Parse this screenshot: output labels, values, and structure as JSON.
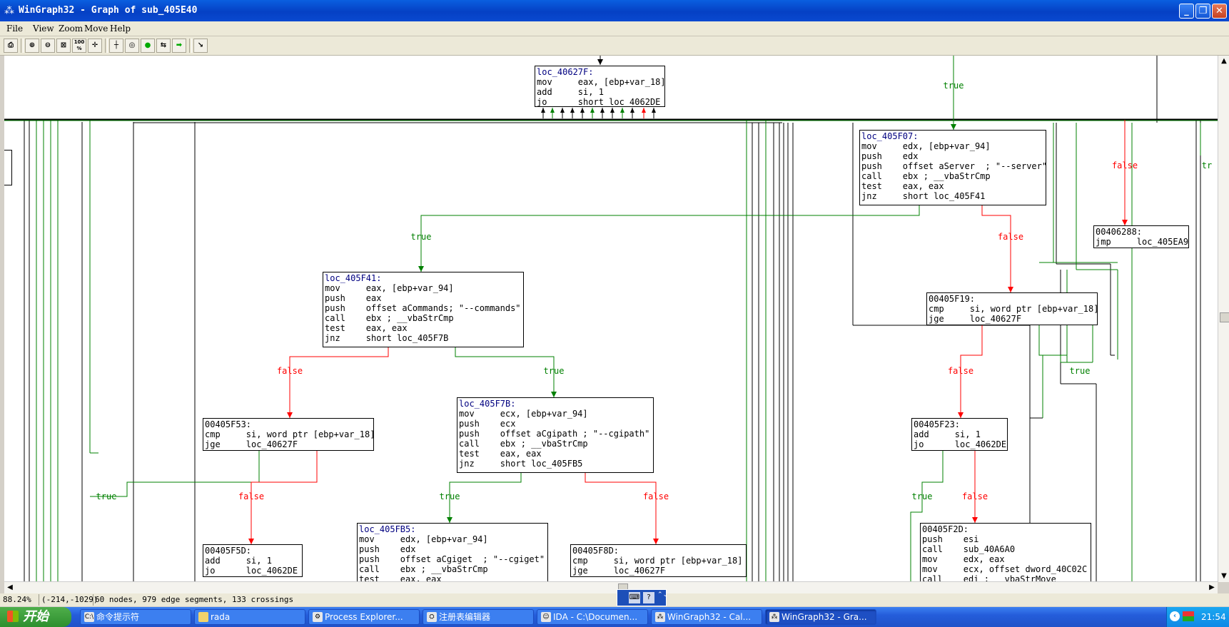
{
  "window": {
    "title": "WinGraph32 - Graph of sub_405E40",
    "minimize": "_",
    "restore": "❐",
    "close": "✕"
  },
  "menu": [
    "File",
    "View",
    "Zoom",
    "Move",
    "Help"
  ],
  "toolbar": {
    "buttons": [
      "print-icon",
      "zoom-in-icon",
      "zoom-out-icon",
      "fit-icon",
      "zoom-100-icon",
      "center-icon",
      "layout-icon",
      "circle-icon",
      "green-circle-icon",
      "swap-icon",
      "green-arrow-icon",
      "cursor-icon"
    ],
    "zoom_100_label": "100 %"
  },
  "graph": {
    "nodes": [
      {
        "id": "n-40627f",
        "lines": [
          "loc_40627F:",
          "mov     eax, [ebp+var_18]",
          "add     si, 1",
          "jo      short loc_4062DE"
        ]
      },
      {
        "id": "n-405f07",
        "lines": [
          "loc_405F07:",
          "mov     edx, [ebp+var_94]",
          "push    edx",
          "push    offset aServer  ; \"--server\"",
          "call    ebx ; __vbaStrCmp",
          "test    eax, eax",
          "jnz     short loc_405F41"
        ]
      },
      {
        "id": "n-406288",
        "lines": [
          "00406288:",
          "jmp     loc_405EA9"
        ]
      },
      {
        "id": "n-405f41",
        "lines": [
          "loc_405F41:",
          "mov     eax, [ebp+var_94]",
          "push    eax",
          "push    offset aCommands; \"--commands\"",
          "call    ebx ; __vbaStrCmp",
          "test    eax, eax",
          "jnz     short loc_405F7B"
        ]
      },
      {
        "id": "n-405f19",
        "lines": [
          "00405F19:",
          "cmp     si, word ptr [ebp+var_18]",
          "jge     loc_40627F"
        ]
      },
      {
        "id": "n-405f53",
        "lines": [
          "00405F53:",
          "cmp     si, word ptr [ebp+var_18]",
          "jge     loc_40627F"
        ]
      },
      {
        "id": "n-405f7b",
        "lines": [
          "loc_405F7B:",
          "mov     ecx, [ebp+var_94]",
          "push    ecx",
          "push    offset aCgipath ; \"--cgipath\"",
          "call    ebx ; __vbaStrCmp",
          "test    eax, eax",
          "jnz     short loc_405FB5"
        ]
      },
      {
        "id": "n-405f23",
        "lines": [
          "00405F23:",
          "add     si, 1",
          "jo      loc_4062DE"
        ]
      },
      {
        "id": "n-405f5d",
        "lines": [
          "00405F5D:",
          "add     si, 1",
          "jo      loc_4062DE"
        ]
      },
      {
        "id": "n-405fb5",
        "lines": [
          "loc_405FB5:",
          "mov     edx, [ebp+var_94]",
          "push    edx",
          "push    offset aCgiget  ; \"--cgiget\"",
          "call    ebx ; __vbaStrCmp",
          "test    eax, eax"
        ]
      },
      {
        "id": "n-405f8d",
        "lines": [
          "00405F8D:",
          "cmp     si, word ptr [ebp+var_18]",
          "jge     loc_40627F"
        ]
      },
      {
        "id": "n-405f2d",
        "lines": [
          "00405F2D:",
          "push    esi",
          "call    sub_40A6A0",
          "mov     edx, eax",
          "mov     ecx, offset dword_40C02C",
          "call    edi ; __vbaStrMove"
        ]
      }
    ],
    "edge_labels": {
      "true": "true",
      "false": "false",
      "tr": "tr"
    },
    "colors": {
      "true": "#008000",
      "false": "#ff0000",
      "plain": "#000000",
      "label_text": "#000080"
    }
  },
  "status": {
    "zoom": "88.24%",
    "position": "(-214,-1029)",
    "summary": "60 nodes, 979 edge segments, 133 crossings"
  },
  "taskbar": {
    "start": "开始",
    "tasks": [
      {
        "label": "命令提示符",
        "icon": "C:\\"
      },
      {
        "label": "rada",
        "icon": "📁"
      },
      {
        "label": "Process Explorer...",
        "icon": "⚙"
      },
      {
        "label": "注册表编辑器",
        "icon": "⛭"
      },
      {
        "label": "IDA - C:\\Documen...",
        "icon": "☺"
      },
      {
        "label": "WinGraph32 - Cal...",
        "icon": "⁂"
      },
      {
        "label": "WinGraph32 - Gra...",
        "icon": "⁂"
      }
    ],
    "clock": "21:54"
  }
}
